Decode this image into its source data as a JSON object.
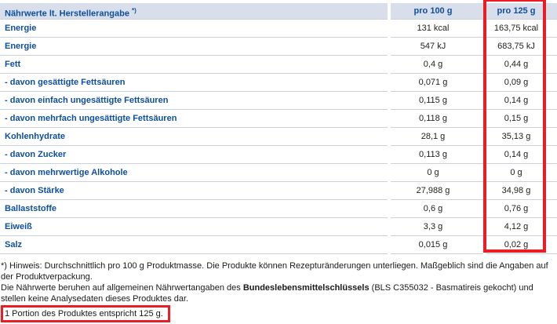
{
  "table": {
    "header": {
      "label": "Nährwerte lt. Herstellerangabe",
      "label_marker": "*)",
      "col_100": "pro 100 g",
      "col_125": "pro 125 g"
    },
    "rows": [
      {
        "label": "Energie",
        "per100": "131 kcal",
        "per125": "163,75 kcal"
      },
      {
        "label": "Energie",
        "per100": "547 kJ",
        "per125": "683,75 kJ"
      },
      {
        "label": "Fett",
        "per100": "0,4 g",
        "per125": "0,44 g"
      },
      {
        "label": "- davon gesättigte Fettsäuren",
        "per100": "0,071 g",
        "per125": "0,09 g"
      },
      {
        "label": "- davon einfach ungesättigte Fettsäuren",
        "per100": "0,115 g",
        "per125": "0,14 g"
      },
      {
        "label": "- davon mehrfach ungesättigte Fettsäuren",
        "per100": "0,118 g",
        "per125": "0,15 g"
      },
      {
        "label": "Kohlenhydrate",
        "per100": "28,1 g",
        "per125": "35,13 g"
      },
      {
        "label": "- davon Zucker",
        "per100": "0,113 g",
        "per125": "0,14 g"
      },
      {
        "label": "- davon mehrwertige Alkohole",
        "per100": "0 g",
        "per125": "0 g"
      },
      {
        "label": "- davon Stärke",
        "per100": "27,988 g",
        "per125": "34,98 g"
      },
      {
        "label": "Ballaststoffe",
        "per100": "0,6 g",
        "per125": "0,76 g"
      },
      {
        "label": "Eiweiß",
        "per100": "3,3 g",
        "per125": "4,12 g"
      },
      {
        "label": "Salz",
        "per100": "0,015 g",
        "per125": "0,02 g"
      }
    ]
  },
  "footnotes": {
    "note1": "*) Hinweis: Durchschnittlich pro 100 g Produktmasse. Die Produkte können Rezepturänderungen unterliegen. Maßgeblich sind die Angaben auf der Produktverpackung.",
    "note2_prefix": "Die Nährwerte beruhen auf allgemeinen Nährwertangaben des ",
    "note2_bold": "Bundeslebensmittelschlüssels",
    "note2_suffix": " (BLS C355032 - Basmatireis gekocht) und stellen keine Analysedaten dieses Produktes dar.",
    "portion": "1 Portion des Produktes entspricht 125 g."
  },
  "colors": {
    "label_blue": "#0d4f9e",
    "header_bg": "#d9dfea",
    "row_border": "#cbd0da",
    "highlight_red": "#ec1c24",
    "value_text": "#222222"
  }
}
